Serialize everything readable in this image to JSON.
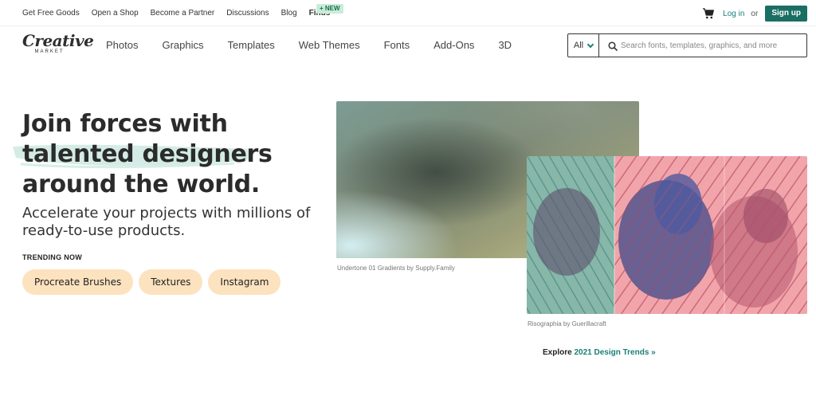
{
  "topbar": {
    "links": [
      "Get Free Goods",
      "Open a Shop",
      "Become a Partner",
      "Discussions",
      "Blog"
    ],
    "finds": "Finds",
    "new_badge": "+ NEW",
    "cart_icon": "cart-icon",
    "login": "Log in",
    "or": "or",
    "signup": "Sign up"
  },
  "logo": {
    "word": "Creative",
    "sub": "MARKET"
  },
  "nav": {
    "items": [
      "Photos",
      "Graphics",
      "Templates",
      "Web Themes",
      "Fonts",
      "Add-Ons",
      "3D"
    ]
  },
  "search": {
    "category": "All",
    "placeholder": "Search fonts, templates, graphics, and more",
    "icon": "search-icon"
  },
  "hero": {
    "headline_lines": [
      "Join forces with",
      "talented designers",
      "around the world."
    ],
    "subhead_lines": [
      "Accelerate your projects with millions of",
      "ready-to-use products."
    ],
    "trending_label": "TRENDING NOW",
    "chips": [
      "Procreate Brushes",
      "Textures",
      "Instagram"
    ]
  },
  "images": {
    "caption1": "Undertone 01 Gradients by Supply.Family",
    "caption2": "Risographia by Guerillacraft"
  },
  "explore": {
    "prefix": "Explore",
    "link": "2021 Design Trends »"
  },
  "colors": {
    "accent": "#1a7f78",
    "signup_bg": "#1a6e62",
    "chip_bg": "#fde2bf",
    "badge_bg": "#c9ecd8",
    "brush_stroke": "#cde9e1"
  }
}
